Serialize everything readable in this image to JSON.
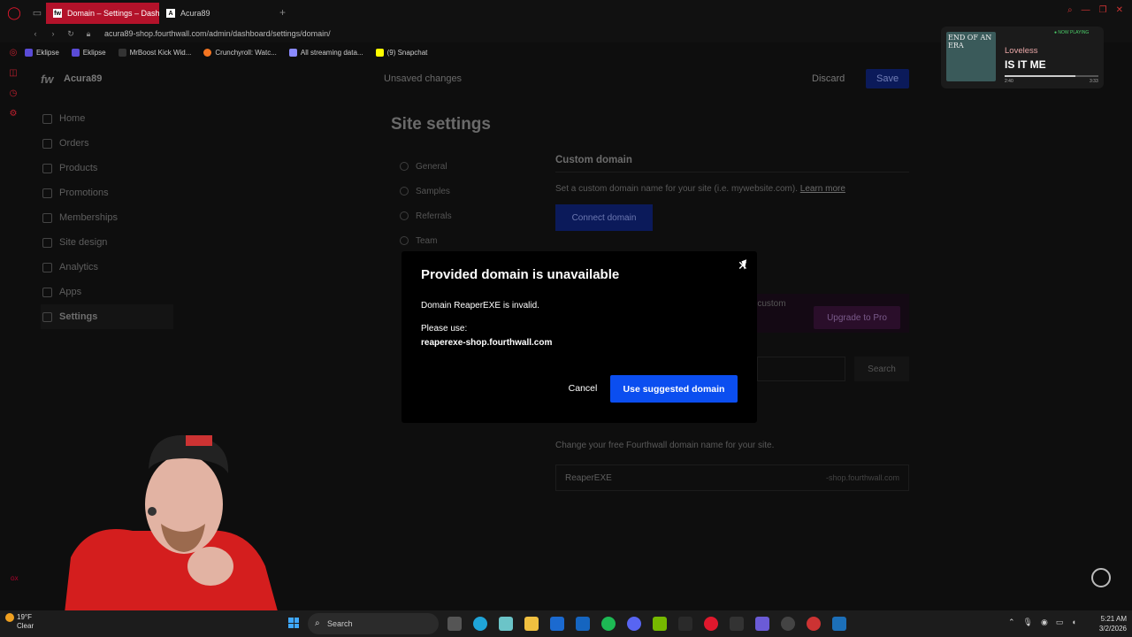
{
  "browser": {
    "tabs": [
      {
        "label": "Domain – Settings – Dashb",
        "active": true
      },
      {
        "label": "Acura89",
        "active": false
      }
    ],
    "url": "acura89-shop.fourthwall.com/admin/dashboard/settings/domain/",
    "bookmarks": [
      "Eklipse",
      "Eklipse",
      "MrBoost Kick Wid...",
      "Crunchyroll: Watc...",
      "All streaming data...",
      "(9) Snapchat"
    ]
  },
  "app": {
    "logo": "fw",
    "store_name": "Acura89",
    "unsaved_label": "Unsaved changes",
    "discard_label": "Discard",
    "save_label": "Save"
  },
  "sidebar": {
    "items": [
      {
        "label": "Home",
        "icon": "home-icon"
      },
      {
        "label": "Orders",
        "icon": "orders-icon"
      },
      {
        "label": "Products",
        "icon": "products-icon"
      },
      {
        "label": "Promotions",
        "icon": "promotions-icon"
      },
      {
        "label": "Memberships",
        "icon": "memberships-icon"
      },
      {
        "label": "Site design",
        "icon": "site-design-icon"
      },
      {
        "label": "Analytics",
        "icon": "analytics-icon"
      },
      {
        "label": "Apps",
        "icon": "apps-icon"
      },
      {
        "label": "Settings",
        "icon": "settings-icon",
        "active": true
      }
    ]
  },
  "settings": {
    "title": "Site settings",
    "subnav": [
      "General",
      "Samples",
      "Referrals",
      "Team"
    ],
    "custom_domain": {
      "title": "Custom domain",
      "description": "Set a custom domain name for your site (i.e. mywebsite.com).",
      "learn_more": "Learn more",
      "connect_label": "Connect domain"
    },
    "behind_modal": {
      "fragment_o": "o",
      "fragment_custom_1": "e custom",
      "fragment_custom_2": "s.",
      "upgrade_label": "Upgrade to Pro",
      "search_label": "Search"
    },
    "free_domain": {
      "description": "Change your free Fourthwall domain name for your site.",
      "value": "ReaperEXE",
      "suffix": "-shop.fourthwall.com"
    }
  },
  "modal": {
    "title": "Provided domain is unavailable",
    "message": "Domain ReaperEXE is invalid.",
    "please_use": "Please use:",
    "suggested": "reaperexe-shop.fourthwall.com",
    "cancel_label": "Cancel",
    "use_label": "Use suggested domain"
  },
  "now_playing": {
    "badge": "● NOW PLAYING",
    "album_text": "END OF AN ERA",
    "artist": "Loveless",
    "song": "IS IT ME",
    "elapsed": "2:40",
    "duration": "3:33",
    "progress": 0.75
  },
  "taskbar": {
    "weather_temp": "19°F",
    "weather_desc": "Clear",
    "search_placeholder": "Search",
    "time": "5:21 AM",
    "date": "3/2/2026"
  },
  "colors": {
    "accent": "#0b4ef0",
    "opera_red": "#e0182d",
    "active_tab": "#b3122a"
  }
}
